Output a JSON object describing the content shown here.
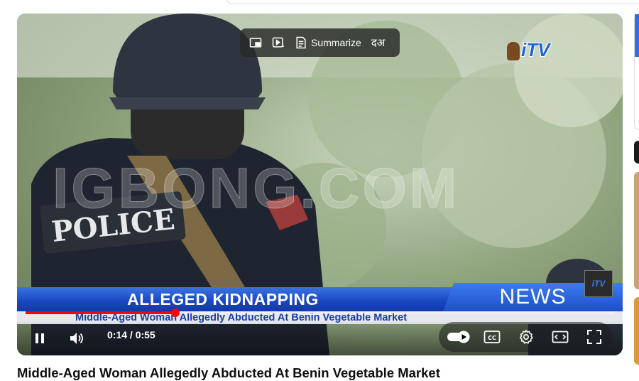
{
  "overlay": {
    "summarize_label": "Summarize",
    "translate_glyph": "दअ"
  },
  "video": {
    "headline": "ALLEGED KIDNAPPING",
    "news_label": "NEWS",
    "ticker": "Middle-Aged Woman Allegedly Abducted At Benin Vegetable Market",
    "channel_logo": "iTV",
    "watermark": "IGBONG.COM",
    "patch_text": "POLICE"
  },
  "player": {
    "time_display": "0:14 / 0:55",
    "progress_fraction": 0.2545
  },
  "title": "Middle-Aged Woman Allegedly Abducted At Benin Vegetable Market",
  "icons": [
    "miniplayer-icon",
    "ai-video-icon",
    "summarize-icon",
    "translate-icon",
    "pause-icon",
    "volume-icon",
    "autoplay-toggle-icon",
    "captions-icon",
    "settings-gear-icon",
    "theater-mode-icon",
    "fullscreen-icon"
  ],
  "colors": {
    "progress": "#ff0000",
    "lower_third": "#1846c2",
    "ticker_text": "#1b3ea6"
  }
}
